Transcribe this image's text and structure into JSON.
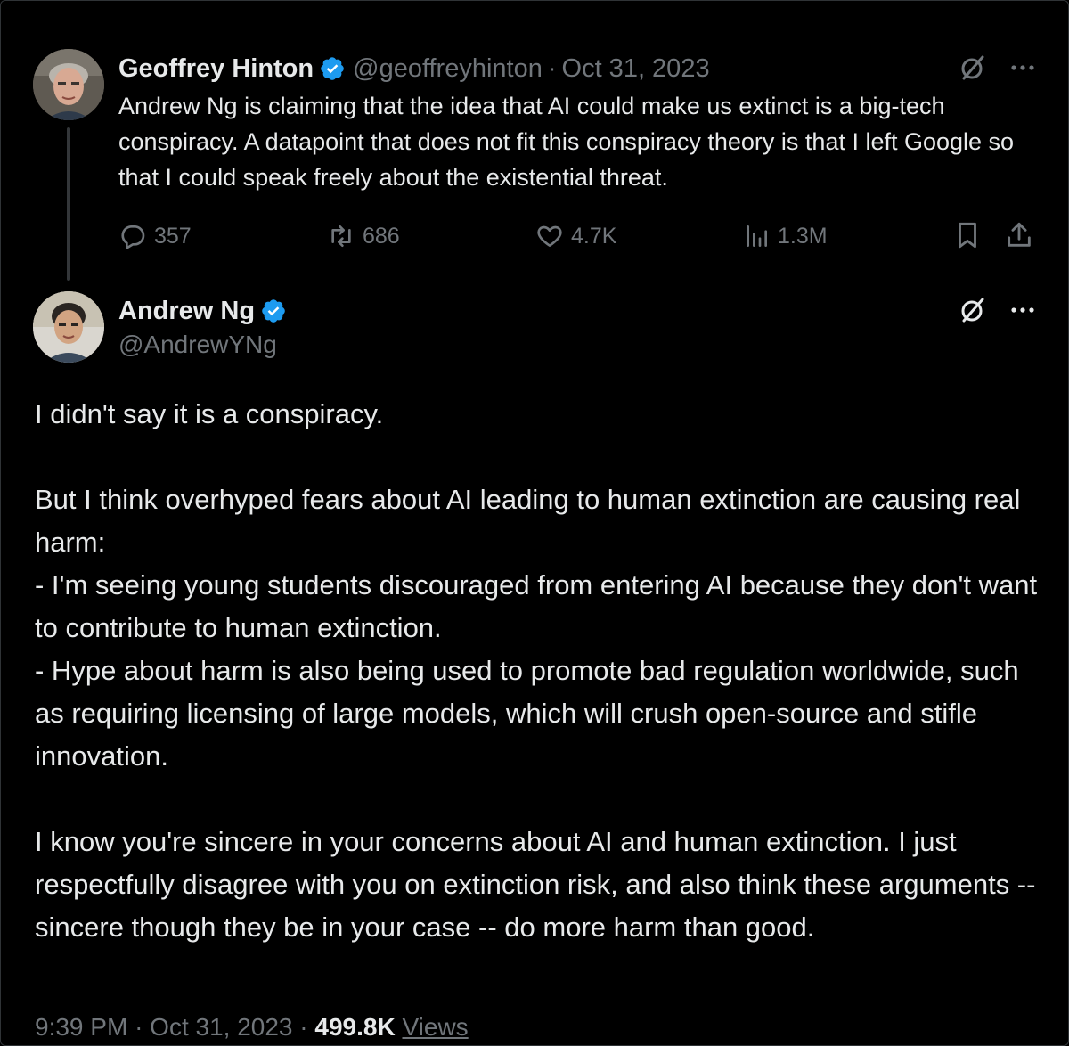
{
  "colors": {
    "background": "#000000",
    "text_primary": "#e7e9ea",
    "text_secondary": "#71767b",
    "verified_badge": "#1d9bf0",
    "thread_line": "#333639"
  },
  "parent_tweet": {
    "author_name": "Geoffrey Hinton",
    "handle": "@geoffreyhinton",
    "separator": "·",
    "date": "Oct 31, 2023",
    "text": "Andrew Ng is claiming that the idea that AI could make us extinct is a big-tech conspiracy. A datapoint that does not fit this conspiracy theory is that I left Google so that I could speak freely about the existential threat.",
    "stats": {
      "replies": "357",
      "reposts": "686",
      "likes": "4.7K",
      "views": "1.3M"
    },
    "icons": [
      "grok-icon",
      "more-icon",
      "reply-icon",
      "repost-icon",
      "like-icon",
      "views-icon",
      "bookmark-icon",
      "share-icon"
    ]
  },
  "main_tweet": {
    "author_name": "Andrew Ng",
    "handle": "@AndrewYNg",
    "paragraphs": [
      "I didn't say it is a conspiracy.",
      "But I think overhyped fears about AI leading to human extinction are causing real harm:",
      "- I'm seeing young students discouraged from entering AI because they don't want to contribute to human extinction.",
      "- Hype about harm is also being used to promote bad regulation worldwide, such as requiring licensing of large models, which will crush open-source and stifle innovation.",
      "I know you're sincere in your concerns about AI and human extinction. I just respectfully disagree with you on extinction risk, and also think these arguments -- sincere though they be in your case -- do more harm than good."
    ],
    "footer": {
      "time": "9:39 PM",
      "separator": "·",
      "date": "Oct 31, 2023",
      "separator2": "·",
      "views_count": "499.8K",
      "views_label": "Views"
    },
    "icons": [
      "grok-icon",
      "more-icon"
    ]
  }
}
